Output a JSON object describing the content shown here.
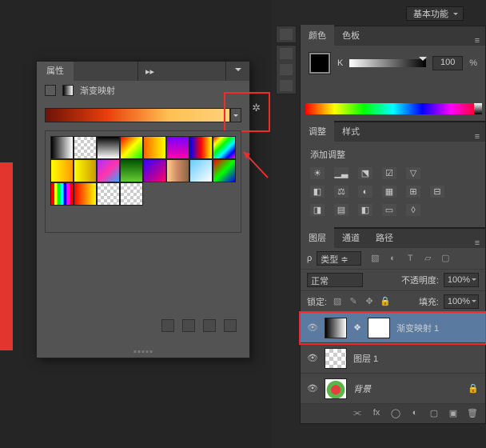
{
  "top_dropdown": {
    "label": "基本功能"
  },
  "props": {
    "tab": "属性",
    "title": "渐变映射"
  },
  "color_panel": {
    "tabs": [
      "颜色",
      "色板"
    ],
    "mode": "K",
    "value": "100",
    "unit": "%"
  },
  "adjust_panel": {
    "tabs": [
      "调整",
      "样式"
    ],
    "heading": "添加调整"
  },
  "layers_panel": {
    "tabs": [
      "图层",
      "通道",
      "路径"
    ],
    "kind_label": "类型",
    "blend_mode": "正常",
    "opacity_label": "不透明度:",
    "opacity_value": "100%",
    "lock_label": "锁定:",
    "fill_label": "填充:",
    "fill_value": "100%",
    "layers": [
      {
        "name": "渐变映射 1"
      },
      {
        "name": "图层 1"
      },
      {
        "name": "背景"
      }
    ]
  }
}
